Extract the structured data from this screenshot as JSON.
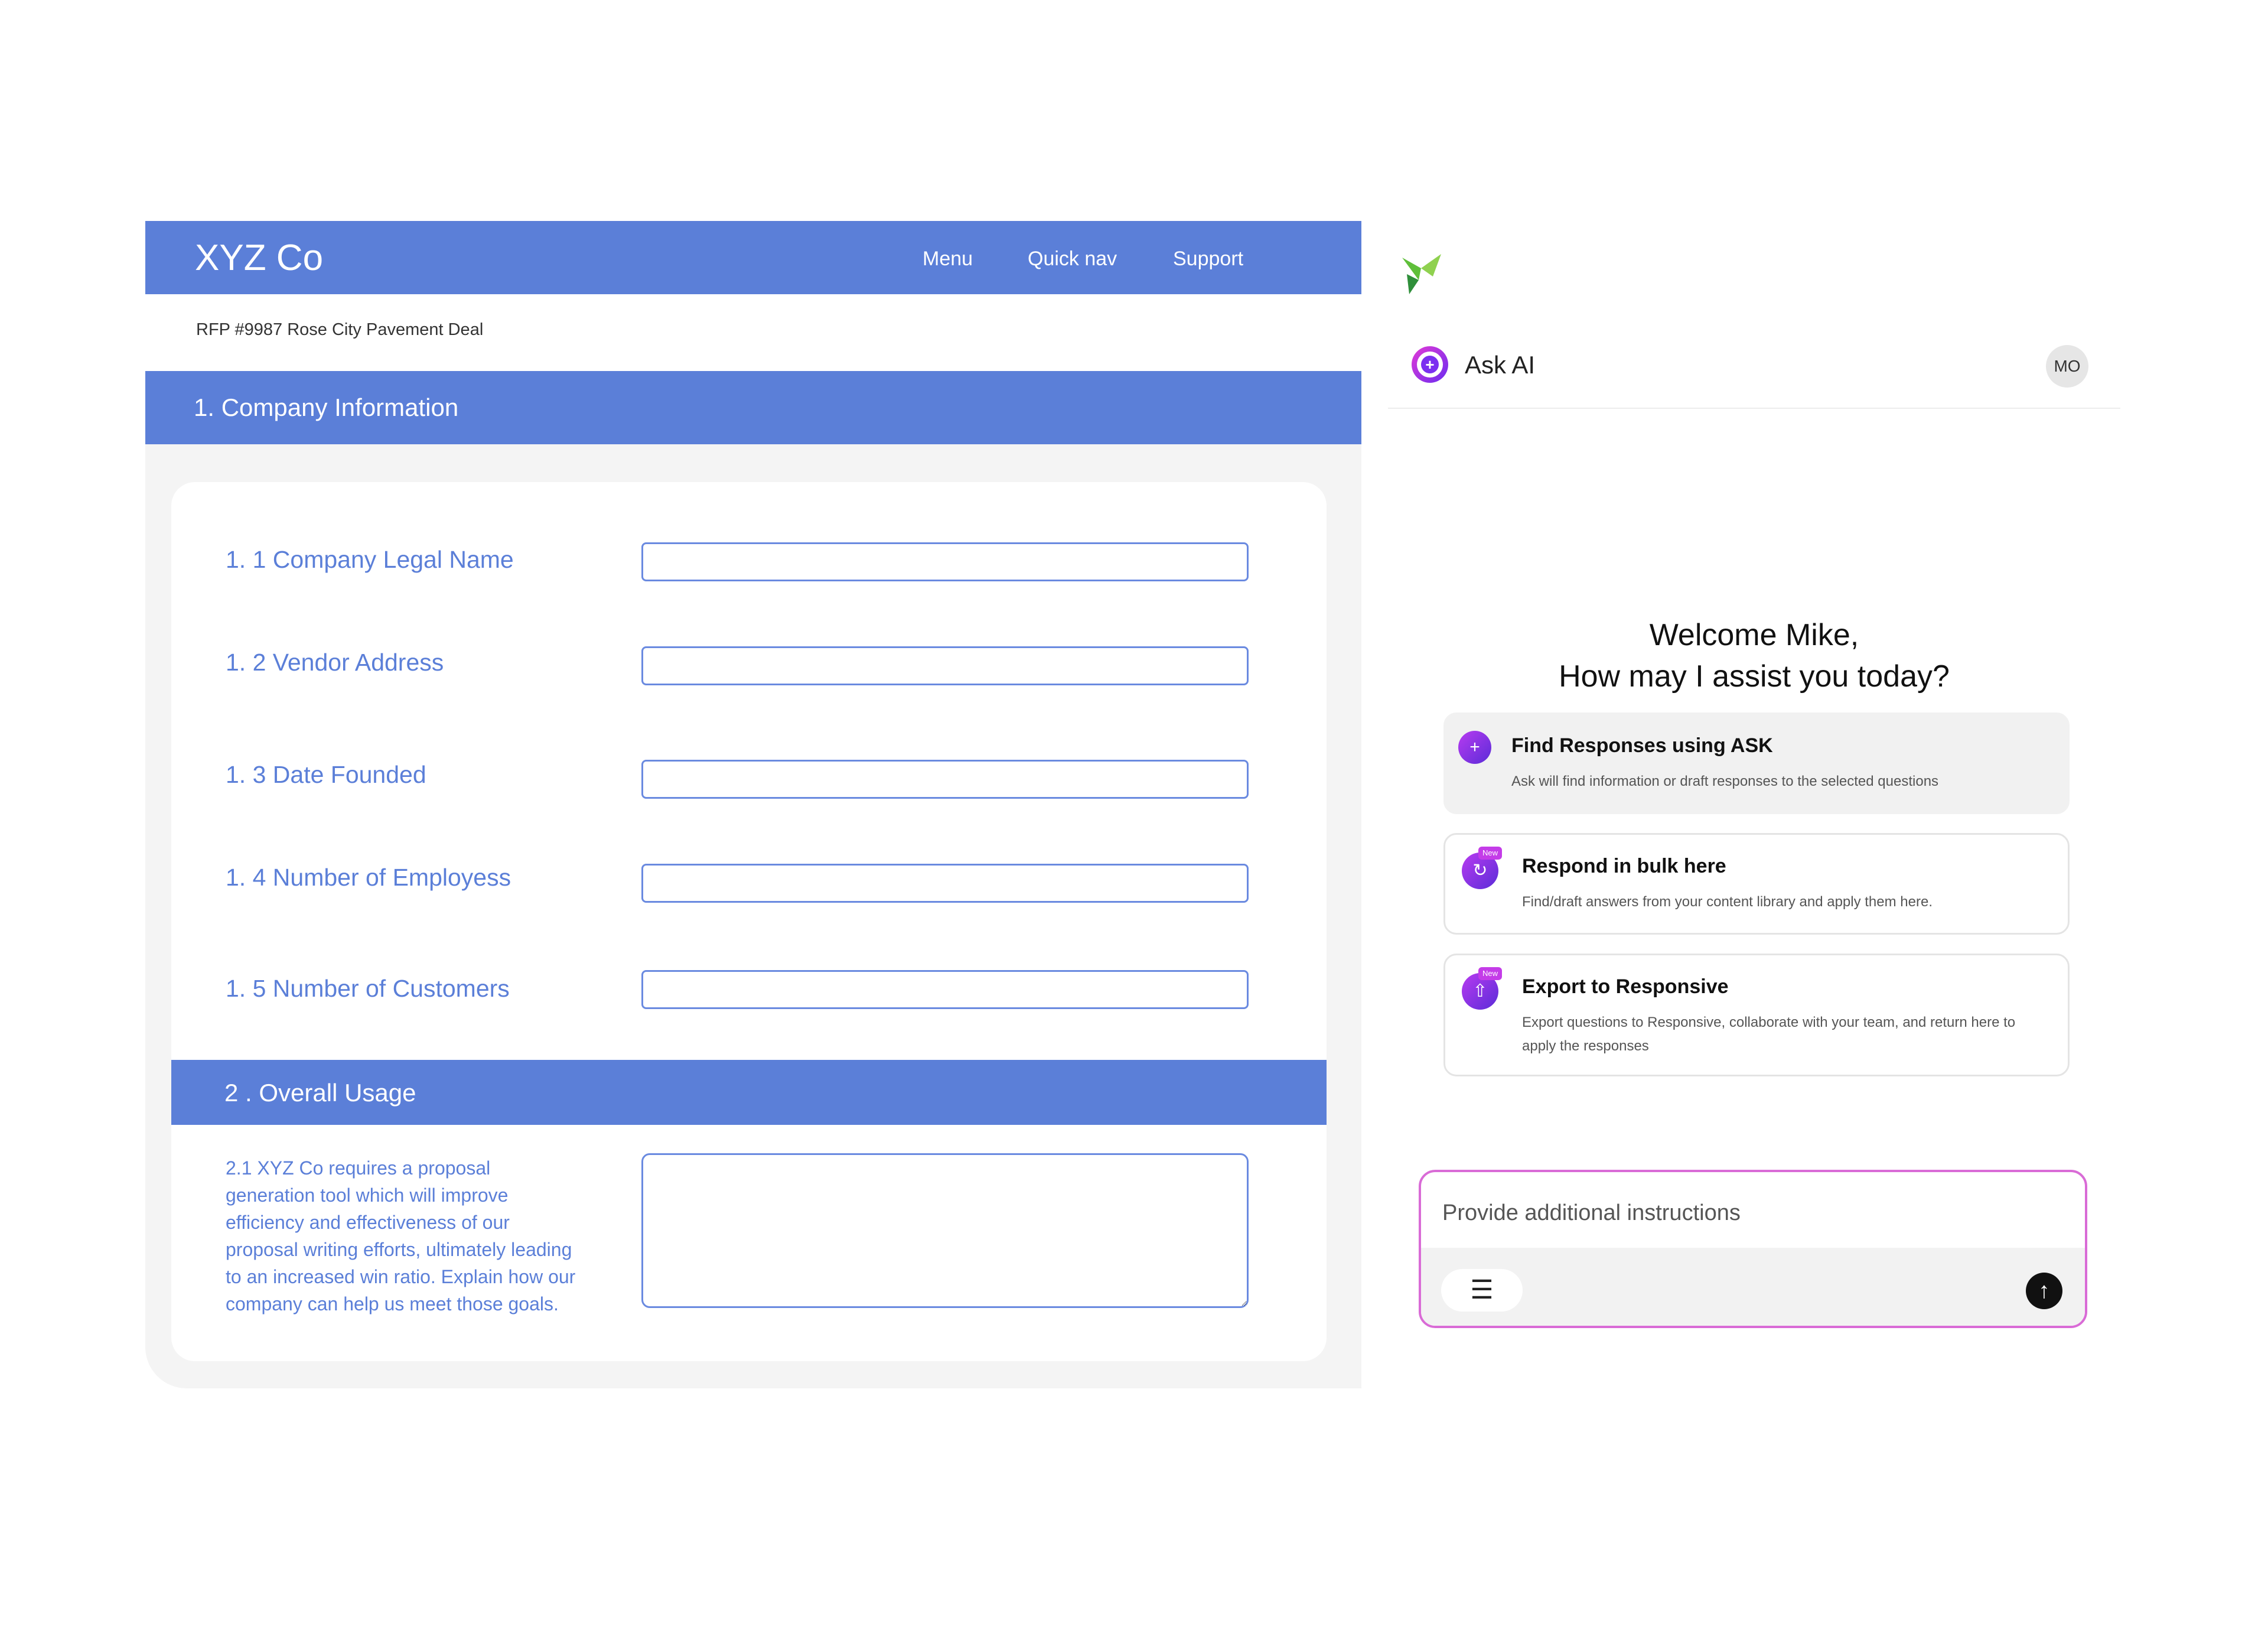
{
  "rfp": {
    "brand": "XYZ Co",
    "nav": {
      "menu": "Menu",
      "quick_nav": "Quick nav",
      "support": "Support"
    },
    "subtitle": "RFP #9987 Rose City Pavement Deal",
    "section1_title": "1. Company Information",
    "fields": [
      {
        "label": "1. 1 Company Legal Name",
        "value": ""
      },
      {
        "label": "1. 2 Vendor Address",
        "value": ""
      },
      {
        "label": "1. 3 Date Founded",
        "value": ""
      },
      {
        "label": "1. 4 Number of Employess",
        "value": ""
      },
      {
        "label": "1. 5 Number of Customers",
        "value": ""
      }
    ],
    "section2_title": "2 . Overall Usage",
    "usage_question": "2.1 XYZ Co requires a proposal generation tool which will improve efficiency and effectiveness of our proposal writing efforts, ultimately leading to an increased win ratio. Explain how our company can help us meet those goals.",
    "usage_value": ""
  },
  "ask": {
    "logo_icon": "green-leaf-logo",
    "title": "Ask AI",
    "avatar_initials": "MO",
    "welcome_line1": "Welcome Mike,",
    "welcome_line2": "How may I assist you today?",
    "cards": [
      {
        "icon": "ask-plus-icon",
        "title": "Find Responses using ASK",
        "desc": "Ask will find information or draft responses to the selected questions"
      },
      {
        "icon": "bulk-respond-icon",
        "badge": "New",
        "title": "Respond in bulk here",
        "desc": "Find/draft answers from your content library and apply them here."
      },
      {
        "icon": "export-upload-icon",
        "badge": "New",
        "title": "Export to Responsive",
        "desc": "Export questions to Responsive, collaborate with your team, and return here to apply the responses"
      }
    ],
    "input_placeholder": "Provide additional instructions",
    "filter_icon": "sliders-icon",
    "send_icon": "arrow-up-icon"
  },
  "colors": {
    "header_blue": "#5b7fd8",
    "accent_purple": "#7b2ff0",
    "accent_pink": "#d96bd6"
  }
}
